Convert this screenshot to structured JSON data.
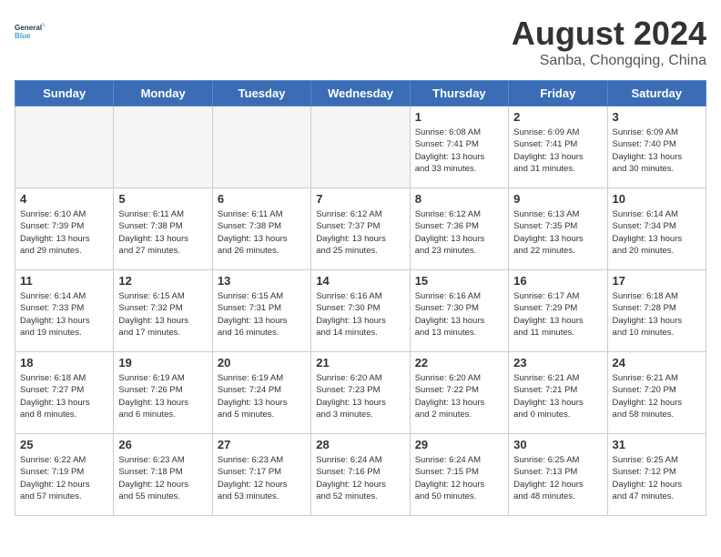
{
  "logo": {
    "line1": "General",
    "line2": "Blue"
  },
  "title": "August 2024",
  "subtitle": "Sanba, Chongqing, China",
  "weekdays": [
    "Sunday",
    "Monday",
    "Tuesday",
    "Wednesday",
    "Thursday",
    "Friday",
    "Saturday"
  ],
  "weeks": [
    [
      {
        "day": "",
        "info": ""
      },
      {
        "day": "",
        "info": ""
      },
      {
        "day": "",
        "info": ""
      },
      {
        "day": "",
        "info": ""
      },
      {
        "day": "1",
        "info": "Sunrise: 6:08 AM\nSunset: 7:41 PM\nDaylight: 13 hours\nand 33 minutes."
      },
      {
        "day": "2",
        "info": "Sunrise: 6:09 AM\nSunset: 7:41 PM\nDaylight: 13 hours\nand 31 minutes."
      },
      {
        "day": "3",
        "info": "Sunrise: 6:09 AM\nSunset: 7:40 PM\nDaylight: 13 hours\nand 30 minutes."
      }
    ],
    [
      {
        "day": "4",
        "info": "Sunrise: 6:10 AM\nSunset: 7:39 PM\nDaylight: 13 hours\nand 29 minutes."
      },
      {
        "day": "5",
        "info": "Sunrise: 6:11 AM\nSunset: 7:38 PM\nDaylight: 13 hours\nand 27 minutes."
      },
      {
        "day": "6",
        "info": "Sunrise: 6:11 AM\nSunset: 7:38 PM\nDaylight: 13 hours\nand 26 minutes."
      },
      {
        "day": "7",
        "info": "Sunrise: 6:12 AM\nSunset: 7:37 PM\nDaylight: 13 hours\nand 25 minutes."
      },
      {
        "day": "8",
        "info": "Sunrise: 6:12 AM\nSunset: 7:36 PM\nDaylight: 13 hours\nand 23 minutes."
      },
      {
        "day": "9",
        "info": "Sunrise: 6:13 AM\nSunset: 7:35 PM\nDaylight: 13 hours\nand 22 minutes."
      },
      {
        "day": "10",
        "info": "Sunrise: 6:14 AM\nSunset: 7:34 PM\nDaylight: 13 hours\nand 20 minutes."
      }
    ],
    [
      {
        "day": "11",
        "info": "Sunrise: 6:14 AM\nSunset: 7:33 PM\nDaylight: 13 hours\nand 19 minutes."
      },
      {
        "day": "12",
        "info": "Sunrise: 6:15 AM\nSunset: 7:32 PM\nDaylight: 13 hours\nand 17 minutes."
      },
      {
        "day": "13",
        "info": "Sunrise: 6:15 AM\nSunset: 7:31 PM\nDaylight: 13 hours\nand 16 minutes."
      },
      {
        "day": "14",
        "info": "Sunrise: 6:16 AM\nSunset: 7:30 PM\nDaylight: 13 hours\nand 14 minutes."
      },
      {
        "day": "15",
        "info": "Sunrise: 6:16 AM\nSunset: 7:30 PM\nDaylight: 13 hours\nand 13 minutes."
      },
      {
        "day": "16",
        "info": "Sunrise: 6:17 AM\nSunset: 7:29 PM\nDaylight: 13 hours\nand 11 minutes."
      },
      {
        "day": "17",
        "info": "Sunrise: 6:18 AM\nSunset: 7:28 PM\nDaylight: 13 hours\nand 10 minutes."
      }
    ],
    [
      {
        "day": "18",
        "info": "Sunrise: 6:18 AM\nSunset: 7:27 PM\nDaylight: 13 hours\nand 8 minutes."
      },
      {
        "day": "19",
        "info": "Sunrise: 6:19 AM\nSunset: 7:26 PM\nDaylight: 13 hours\nand 6 minutes."
      },
      {
        "day": "20",
        "info": "Sunrise: 6:19 AM\nSunset: 7:24 PM\nDaylight: 13 hours\nand 5 minutes."
      },
      {
        "day": "21",
        "info": "Sunrise: 6:20 AM\nSunset: 7:23 PM\nDaylight: 13 hours\nand 3 minutes."
      },
      {
        "day": "22",
        "info": "Sunrise: 6:20 AM\nSunset: 7:22 PM\nDaylight: 13 hours\nand 2 minutes."
      },
      {
        "day": "23",
        "info": "Sunrise: 6:21 AM\nSunset: 7:21 PM\nDaylight: 13 hours\nand 0 minutes."
      },
      {
        "day": "24",
        "info": "Sunrise: 6:21 AM\nSunset: 7:20 PM\nDaylight: 12 hours\nand 58 minutes."
      }
    ],
    [
      {
        "day": "25",
        "info": "Sunrise: 6:22 AM\nSunset: 7:19 PM\nDaylight: 12 hours\nand 57 minutes."
      },
      {
        "day": "26",
        "info": "Sunrise: 6:23 AM\nSunset: 7:18 PM\nDaylight: 12 hours\nand 55 minutes."
      },
      {
        "day": "27",
        "info": "Sunrise: 6:23 AM\nSunset: 7:17 PM\nDaylight: 12 hours\nand 53 minutes."
      },
      {
        "day": "28",
        "info": "Sunrise: 6:24 AM\nSunset: 7:16 PM\nDaylight: 12 hours\nand 52 minutes."
      },
      {
        "day": "29",
        "info": "Sunrise: 6:24 AM\nSunset: 7:15 PM\nDaylight: 12 hours\nand 50 minutes."
      },
      {
        "day": "30",
        "info": "Sunrise: 6:25 AM\nSunset: 7:13 PM\nDaylight: 12 hours\nand 48 minutes."
      },
      {
        "day": "31",
        "info": "Sunrise: 6:25 AM\nSunset: 7:12 PM\nDaylight: 12 hours\nand 47 minutes."
      }
    ]
  ]
}
